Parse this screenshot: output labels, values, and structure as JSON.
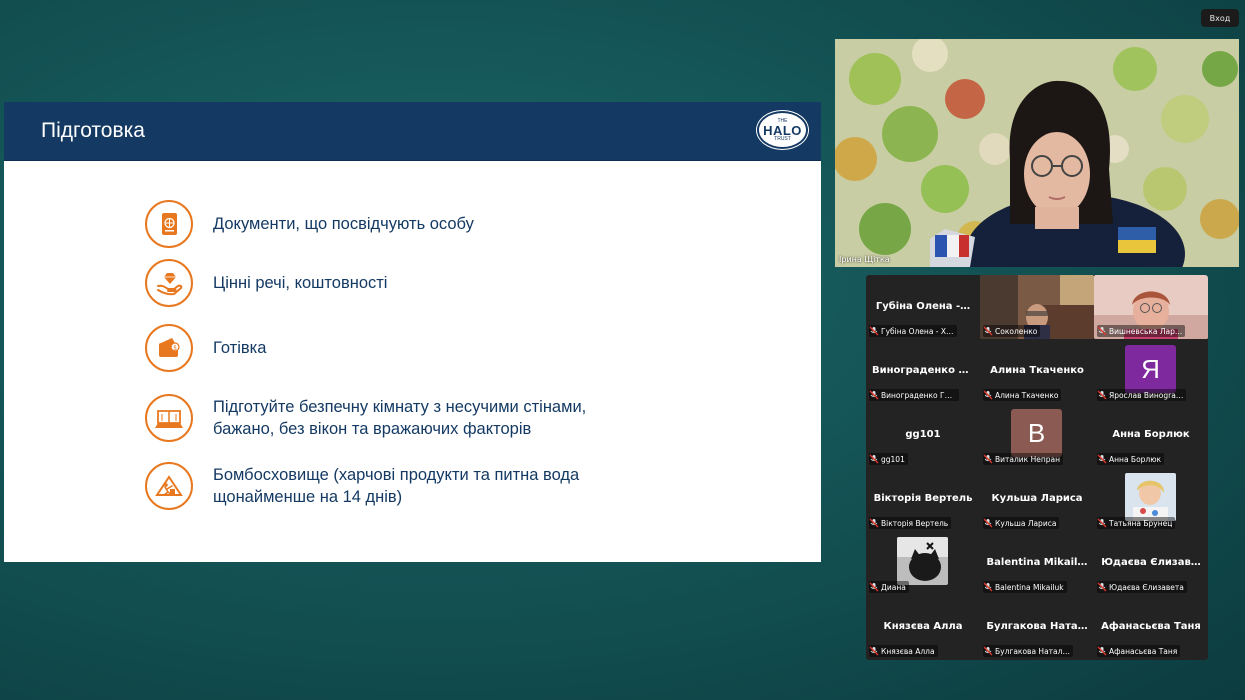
{
  "window": {
    "exit_label": "Вход"
  },
  "slide": {
    "title": "Підготовка",
    "logo": {
      "top": "THE",
      "main": "HALO",
      "bottom": "TRUST"
    },
    "bullets": [
      {
        "icon": "passport-icon",
        "text": "Документи, що посвідчують особу"
      },
      {
        "icon": "valuables-icon",
        "text": "Цінні речі, коштовності"
      },
      {
        "icon": "wallet-icon",
        "text": "Готівка"
      },
      {
        "icon": "room-icon",
        "text": "Підготуйте безпечну кімнату з несучими стінами,\nбажано, без вікон та вражаючих факторів"
      },
      {
        "icon": "shelter-icon",
        "text": "Бомбосховище (харчові продукти та питна вода\nщонайменше на 14 днів)"
      }
    ],
    "accent_color": "#e8781f",
    "header_color": "#143a63"
  },
  "main_video": {
    "speaker_name": "Ірина Щітка"
  },
  "participants": [
    {
      "display": "Губіна Олена -…",
      "label": "Губіна Олена - Х…",
      "type": "name"
    },
    {
      "display": "",
      "label": "Соколенко",
      "type": "photo"
    },
    {
      "display": "",
      "label": "Вишневська Лар…",
      "type": "photo"
    },
    {
      "display": "Винограденко Г…",
      "label": "Винограденко Га…",
      "type": "name"
    },
    {
      "display": "Алина Ткаченко",
      "label": "Алина Ткаченко",
      "type": "name"
    },
    {
      "display": "Я",
      "label": "Ярослав Винogra…",
      "type": "avatar",
      "color": "#7e2a9e"
    },
    {
      "display": "gg101",
      "label": "gg101",
      "type": "name"
    },
    {
      "display": "В",
      "label": "Виталик Непран",
      "type": "avatar",
      "color": "#8b5a52"
    },
    {
      "display": "Анна Борлюк",
      "label": "Анна Борлюк",
      "type": "name"
    },
    {
      "display": "Вікторія Вертель",
      "label": "Вікторія Вертель",
      "type": "name"
    },
    {
      "display": "Кульша Лариса",
      "label": "Кульша Лариса",
      "type": "name"
    },
    {
      "display": "",
      "label": "Татьяна Брунец",
      "type": "photo"
    },
    {
      "display": "",
      "label": "Диана",
      "type": "photo"
    },
    {
      "display": "Balentina Mikail…",
      "label": "Balentina Mikailuk",
      "type": "name"
    },
    {
      "display": "Юдаєва Єлизав…",
      "label": "Юдаєва Єлизавета",
      "type": "name"
    },
    {
      "display": "Князєва Алла",
      "label": "Князєва Алла",
      "type": "name"
    },
    {
      "display": "Булгакова Ната…",
      "label": "Булгакова Наталі…",
      "type": "name"
    },
    {
      "display": "Афанасьєва Таня",
      "label": "Афанасьєва Таня",
      "type": "name"
    }
  ]
}
